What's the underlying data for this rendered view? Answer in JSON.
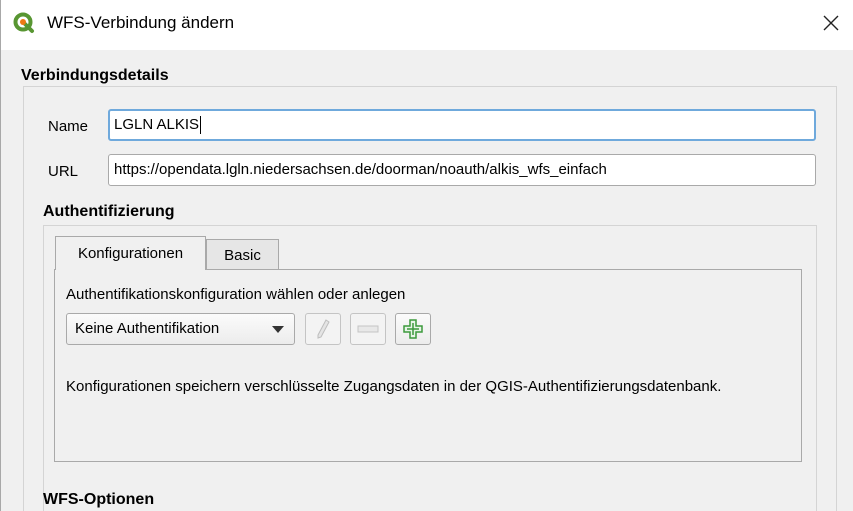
{
  "window": {
    "title": "WFS-Verbindung ändern",
    "close_glyph": "✕"
  },
  "connection": {
    "section_title": "Verbindungsdetails",
    "name_label": "Name",
    "name_value": "LGLN ALKIS",
    "url_label": "URL",
    "url_value": "https://opendata.lgln.niedersachsen.de/doorman/noauth/alkis_wfs_einfach"
  },
  "auth": {
    "section_title": "Authentifizierung",
    "tabs": [
      {
        "label": "Konfigurationen",
        "active": true
      },
      {
        "label": "Basic",
        "active": false
      }
    ],
    "prompt": "Authentifikationskonfiguration wählen oder anlegen",
    "combo_value": "Keine Authentifikation",
    "edit_icon": "pencil-icon",
    "remove_icon": "minus-icon",
    "add_icon": "plus-icon",
    "info_text": "Konfigurationen speichern verschlüsselte Zugangsdaten in der QGIS-Authentifizierungsdatenbank."
  },
  "wfs_options": {
    "section_title": "WFS-Optionen"
  },
  "colors": {
    "focus_border": "#6fa9dc",
    "qgis_green": "#589632",
    "qgis_yellow": "#ee7913",
    "add_green": "#3c9a3c"
  }
}
